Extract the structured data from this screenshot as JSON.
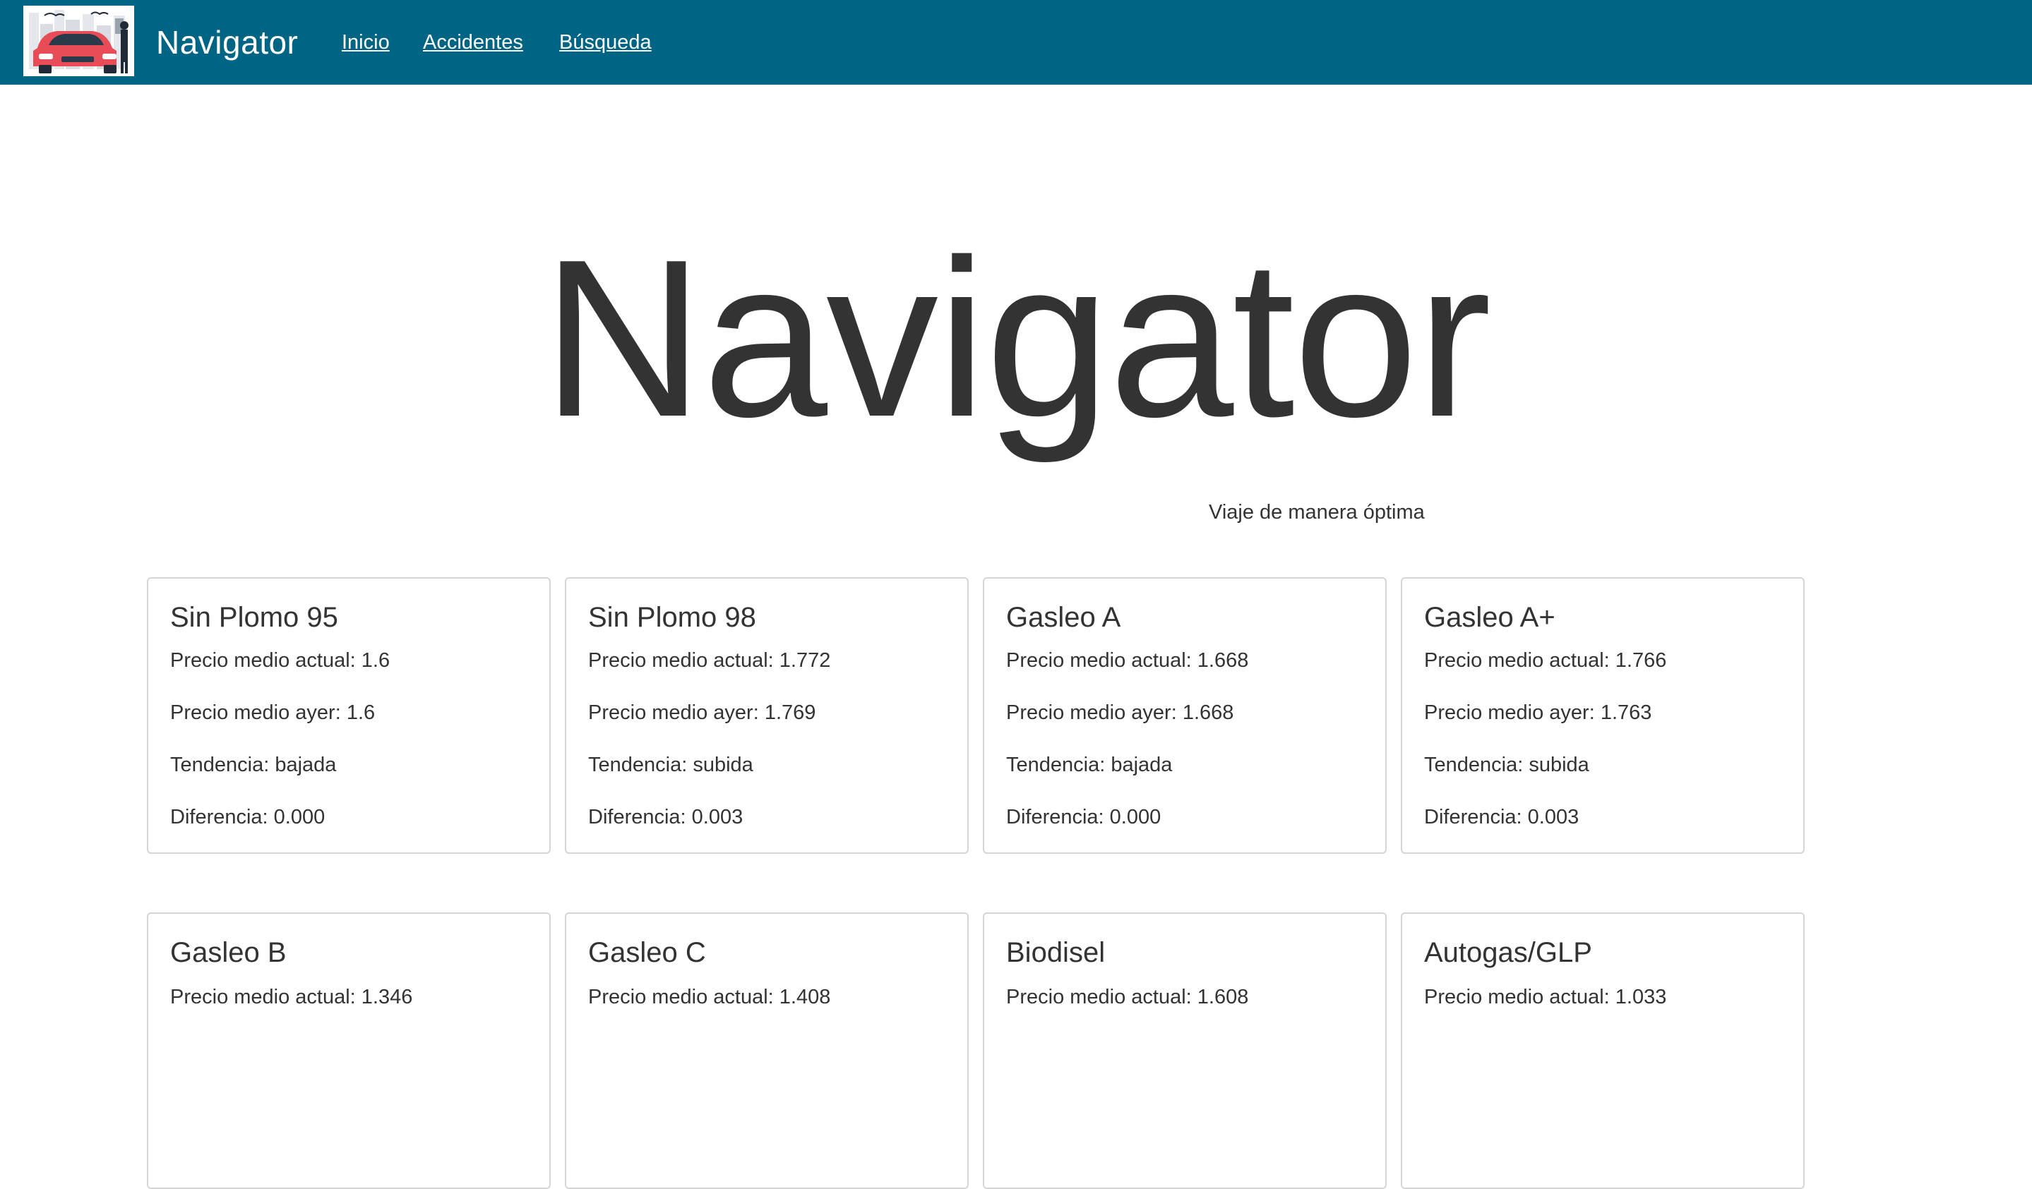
{
  "navbar": {
    "brand": "Navigator",
    "links": [
      "Inicio",
      "Accidentes",
      "Búsqueda"
    ],
    "background": "#006584",
    "logo_icon": "car-city-logo-icon"
  },
  "hero": {
    "title": "Navigator",
    "subtitle": "Viaje de manera óptima"
  },
  "cards": [
    {
      "title": "Sin Plomo 95",
      "lines": [
        "Precio medio actual: 1.6",
        "Precio medio ayer: 1.6",
        "Tendencia: bajada",
        "Diferencia: 0.000"
      ]
    },
    {
      "title": "Sin Plomo 98",
      "lines": [
        "Precio medio actual: 1.772",
        "Precio medio ayer: 1.769",
        "Tendencia: subida",
        "Diferencia: 0.003"
      ]
    },
    {
      "title": "Gasleo A",
      "lines": [
        "Precio medio actual: 1.668",
        "Precio medio ayer: 1.668",
        "Tendencia: bajada",
        "Diferencia: 0.000"
      ]
    },
    {
      "title": "Gasleo A+",
      "lines": [
        "Precio medio actual: 1.766",
        "Precio medio ayer: 1.763",
        "Tendencia: subida",
        "Diferencia: 0.003"
      ]
    },
    {
      "title": "Gasleo B",
      "lines": [
        "Precio medio actual: 1.346"
      ]
    },
    {
      "title": "Gasleo C",
      "lines": [
        "Precio medio actual: 1.408"
      ]
    },
    {
      "title": "Biodisel",
      "lines": [
        "Precio medio actual: 1.608"
      ]
    },
    {
      "title": "Autogas/GLP",
      "lines": [
        "Precio medio actual: 1.033"
      ]
    }
  ]
}
